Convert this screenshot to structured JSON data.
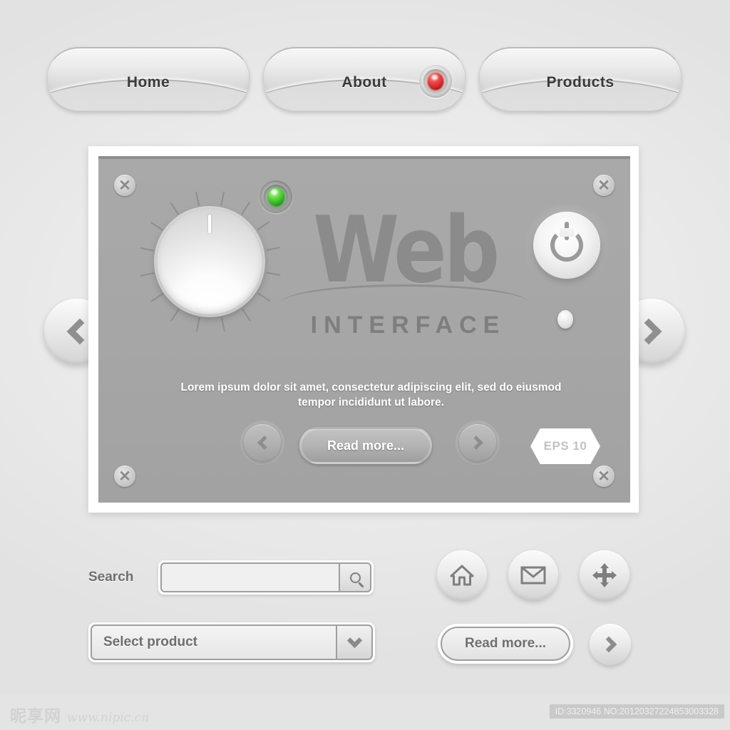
{
  "nav": {
    "tabs": [
      {
        "label": "Home",
        "has_led": false,
        "led_color": ""
      },
      {
        "label": "About",
        "has_led": true,
        "led_color": "#d22626"
      },
      {
        "label": "Products",
        "has_led": false,
        "led_color": ""
      }
    ]
  },
  "side_nav": {
    "prev_icon": "chevron-left-icon",
    "next_icon": "chevron-right-icon"
  },
  "panel": {
    "screws": [
      "screw-x",
      "screw-x",
      "screw-x",
      "screw-x"
    ],
    "screw_glyph": "✕",
    "knob": {
      "name": "volume-knob",
      "tick_count": 16,
      "pointer_angle_deg": 0
    },
    "status_led": {
      "name": "power-status-led",
      "color": "#3fc020",
      "state": "on"
    },
    "logo": {
      "primary": "Web",
      "secondary": "INTERFACE"
    },
    "description": "Lorem ipsum dolor sit amet, consectetur adipiscing elit, sed do eiusmod tempor incididunt ut labore.",
    "power_button_label": "power-icon",
    "indicator_dot": "indicator-dot",
    "prev_label": "chevron-left-icon",
    "next_label": "chevron-right-icon",
    "read_more_label": "Read more...",
    "badge_label": "EPS 10"
  },
  "search": {
    "label": "Search",
    "value": "",
    "placeholder": "",
    "submit_icon": "search-icon"
  },
  "select": {
    "value": "Select product",
    "caret_icon": "chevron-down-icon"
  },
  "icon_buttons": [
    {
      "name": "home-icon",
      "label": "Home"
    },
    {
      "name": "mail-icon",
      "label": "Mail"
    },
    {
      "name": "move-icon",
      "label": "Move"
    }
  ],
  "bottom_actions": {
    "read_more_label": "Read more...",
    "next_icon": "chevron-right-icon"
  },
  "watermark": {
    "brand_cn": "昵享网",
    "brand_url": "www.nipic.cn",
    "id_text": "ID:3320946 NO:20120327224853003328"
  },
  "colors": {
    "panel_bg": "#a6a6a6",
    "page_bg": "#eaeaea",
    "led_green": "#3fc020",
    "led_red": "#d22626",
    "text_gray": "#6e6e6e"
  }
}
